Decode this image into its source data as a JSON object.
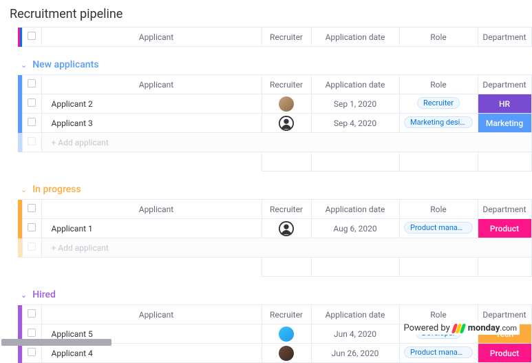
{
  "title": "Recruitment pipeline",
  "columns": {
    "applicant": "Applicant",
    "recruiter": "Recruiter",
    "date": "Application date",
    "role": "Role",
    "department": "Department"
  },
  "add_label": "+ Add applicant",
  "top_accent": "#ff158a",
  "groups": [
    {
      "id": "new",
      "name": "New applicants",
      "color": "#579bfc",
      "rows": [
        {
          "name": "Applicant 2",
          "avatar": "photo1",
          "date": "Sep 1, 2020",
          "role": "Recruiter",
          "dept": "HR",
          "dept_color": "#784bd1"
        },
        {
          "name": "Applicant 3",
          "avatar": "default",
          "date": "Sep 4, 2020",
          "role": "Marketing designer",
          "dept": "Marketing",
          "dept_color": "#579bfc"
        }
      ]
    },
    {
      "id": "prog",
      "name": "In progress",
      "color": "#fdab3d",
      "rows": [
        {
          "name": "Applicant 1",
          "avatar": "default",
          "date": "Aug 6, 2020",
          "role": "Product manager",
          "dept": "Product",
          "dept_color": "#ff158a"
        }
      ]
    },
    {
      "id": "hired",
      "name": "Hired",
      "color": "#a25ddc",
      "rows": [
        {
          "name": "Applicant 5",
          "avatar": "photo2",
          "date": "Jun 4, 2020",
          "role": "Developer",
          "dept": "Tech",
          "dept_color": "#fdab3d"
        },
        {
          "name": "Applicant 4",
          "avatar": "photo3",
          "date": "Jun 26, 2020",
          "role": "Product manager",
          "dept": "Product",
          "dept_color": "#ff158a"
        }
      ]
    }
  ],
  "footer": {
    "powered_by": "Powered by",
    "brand": "monday",
    "tld": ".com"
  }
}
